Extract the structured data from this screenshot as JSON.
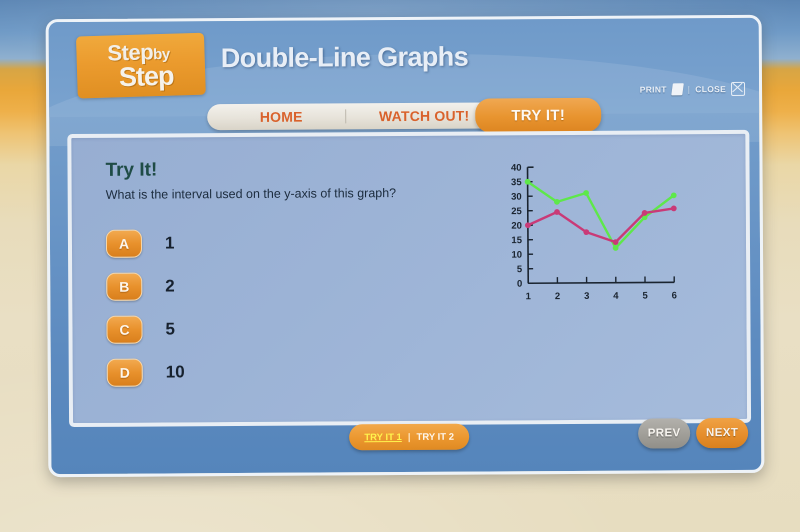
{
  "logo": {
    "line1": "Step",
    "line1_small": "by",
    "line2": "Step"
  },
  "header": {
    "title": "Double-Line Graphs",
    "print_label": "PRINT",
    "separator": "|",
    "close_label": "CLOSE",
    "print_icon": "page-icon",
    "close_icon": "close-box-icon"
  },
  "tabs": [
    {
      "id": "home",
      "label": "HOME",
      "active": false
    },
    {
      "id": "watchout",
      "label": "WATCH OUT!",
      "active": false
    },
    {
      "id": "tryit",
      "label": "TRY IT!",
      "active": true
    }
  ],
  "question": {
    "heading": "Try It!",
    "prompt": "What is the interval used on the y-axis of this graph?"
  },
  "answers": [
    {
      "letter": "A",
      "label": "1"
    },
    {
      "letter": "B",
      "label": "2"
    },
    {
      "letter": "C",
      "label": "5"
    },
    {
      "letter": "D",
      "label": "10"
    }
  ],
  "footer": {
    "tryit1_label": "TRY IT 1",
    "pager_separator": "|",
    "tryit2_label": "TRY IT 2",
    "prev_label": "PREV",
    "next_label": "NEXT"
  },
  "colors": {
    "accent_orange": "#e8942f",
    "tab_text": "#d9622c",
    "heading_green": "#1f4c46",
    "series_green": "#5ee84a",
    "series_pink": "#c93a77",
    "active_link_yellow": "#fff34d",
    "panel_blue": "#9cb3d6"
  },
  "chart_data": {
    "type": "line",
    "title": "",
    "xlabel": "",
    "ylabel": "",
    "x": [
      1,
      2,
      3,
      4,
      5,
      6
    ],
    "xticklabels": [
      "1",
      "2",
      "3",
      "4",
      "5",
      "6"
    ],
    "yticklabels": [
      "0",
      "5",
      "10",
      "15",
      "20",
      "25",
      "30",
      "35",
      "40"
    ],
    "yticks": [
      0,
      5,
      10,
      15,
      20,
      25,
      30,
      35,
      40
    ],
    "ylim": [
      0,
      40
    ],
    "xlim": [
      1,
      6
    ],
    "y_interval": 5,
    "grid": false,
    "legend": "none",
    "series": [
      {
        "name": "green",
        "color": "#5ee84a",
        "values": [
          35,
          28,
          31,
          12,
          22.5,
          30
        ]
      },
      {
        "name": "pink",
        "color": "#c93a77",
        "values": [
          20,
          24.5,
          17.5,
          14,
          24,
          25.5
        ]
      }
    ]
  }
}
